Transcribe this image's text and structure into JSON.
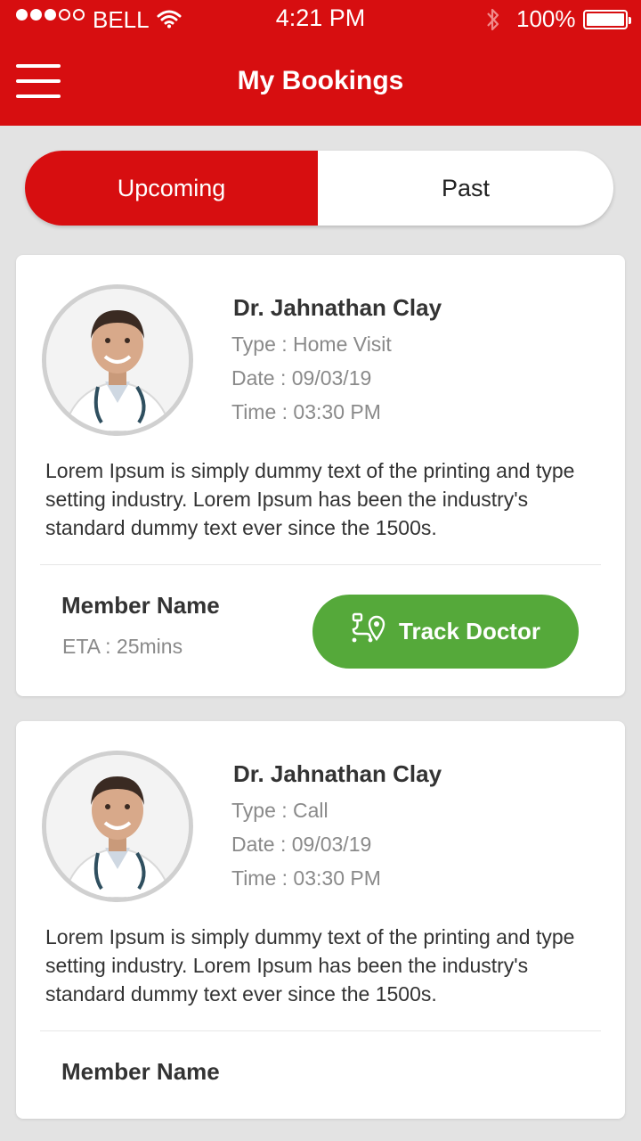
{
  "status_bar": {
    "carrier": "BELL",
    "time": "4:21 PM",
    "battery": "100%"
  },
  "header": {
    "title": "My Bookings"
  },
  "tabs": {
    "upcoming": "Upcoming",
    "past": "Past",
    "active": "upcoming"
  },
  "bookings": [
    {
      "doctor": "Dr. Jahnathan Clay",
      "type": "Type : Home Visit",
      "date": "Date : 09/03/19",
      "time": "Time : 03:30 PM",
      "description": "Lorem Ipsum is simply dummy text of the printing and type setting industry. Lorem Ipsum has been the industry's standard dummy text ever since the 1500s.",
      "member": "Member Name",
      "eta": "ETA : 25mins",
      "action": "Track Doctor"
    },
    {
      "doctor": "Dr. Jahnathan Clay",
      "type": "Type : Call",
      "date": "Date : 09/03/19",
      "time": "Time : 03:30 PM",
      "description": "Lorem Ipsum is simply dummy text of the printing and type setting industry. Lorem Ipsum has been the industry's standard dummy text ever since the 1500s.",
      "member": "Member Name"
    }
  ],
  "colors": {
    "brand": "#d70e10",
    "action": "#55a93a"
  }
}
